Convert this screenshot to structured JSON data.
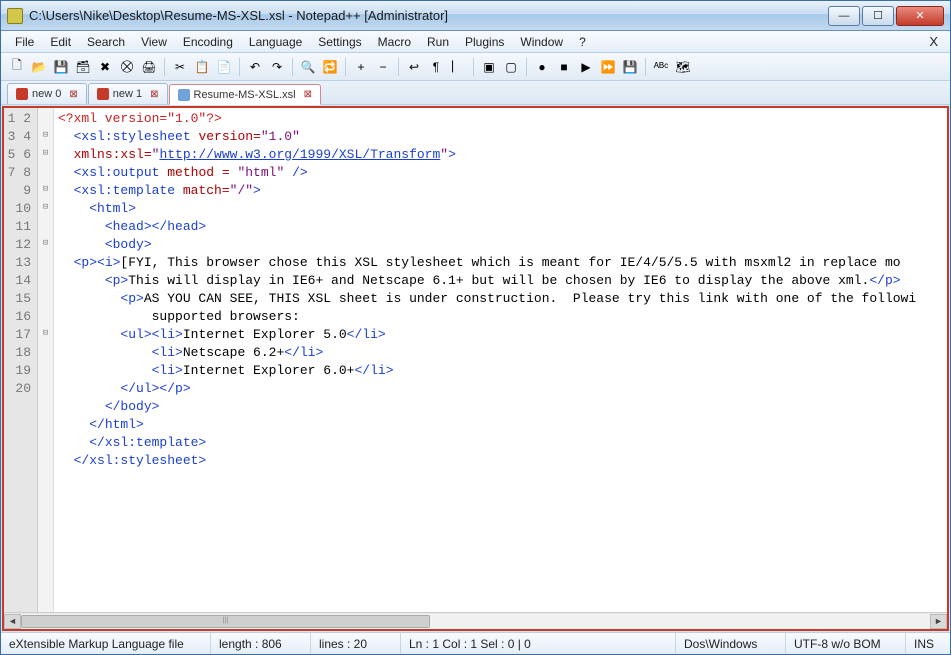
{
  "window": {
    "title": "C:\\Users\\Nike\\Desktop\\Resume-MS-XSL.xsl - Notepad++ [Administrator]"
  },
  "menu": {
    "items": [
      "File",
      "Edit",
      "Search",
      "View",
      "Encoding",
      "Language",
      "Settings",
      "Macro",
      "Run",
      "Plugins",
      "Window",
      "?"
    ],
    "close_doc": "X"
  },
  "toolbar": {
    "buttons": [
      {
        "name": "new-file-icon",
        "glyph": "🗋"
      },
      {
        "name": "open-file-icon",
        "glyph": "📂"
      },
      {
        "name": "save-icon",
        "glyph": "💾"
      },
      {
        "name": "save-all-icon",
        "glyph": "🗃"
      },
      {
        "name": "close-icon",
        "glyph": "✖"
      },
      {
        "name": "close-all-icon",
        "glyph": "⛒"
      },
      {
        "name": "print-icon",
        "glyph": "🖨"
      },
      {
        "sep": true
      },
      {
        "name": "cut-icon",
        "glyph": "✂"
      },
      {
        "name": "copy-icon",
        "glyph": "📋"
      },
      {
        "name": "paste-icon",
        "glyph": "📄"
      },
      {
        "sep": true
      },
      {
        "name": "undo-icon",
        "glyph": "↶"
      },
      {
        "name": "redo-icon",
        "glyph": "↷"
      },
      {
        "sep": true
      },
      {
        "name": "find-icon",
        "glyph": "🔍"
      },
      {
        "name": "replace-icon",
        "glyph": "🔁"
      },
      {
        "sep": true
      },
      {
        "name": "zoom-in-icon",
        "glyph": "+"
      },
      {
        "name": "zoom-out-icon",
        "glyph": "−"
      },
      {
        "sep": true
      },
      {
        "name": "wrap-icon",
        "glyph": "↩"
      },
      {
        "name": "invisible-chars-icon",
        "glyph": "¶"
      },
      {
        "name": "indent-guide-icon",
        "glyph": "⎸"
      },
      {
        "sep": true
      },
      {
        "name": "fold-all-icon",
        "glyph": "▣"
      },
      {
        "name": "unfold-all-icon",
        "glyph": "▢"
      },
      {
        "sep": true
      },
      {
        "name": "record-macro-icon",
        "glyph": "●"
      },
      {
        "name": "stop-macro-icon",
        "glyph": "■"
      },
      {
        "name": "play-macro-icon",
        "glyph": "▶"
      },
      {
        "name": "run-macro-multi-icon",
        "glyph": "⏩"
      },
      {
        "name": "save-macro-icon",
        "glyph": "💾"
      },
      {
        "sep": true
      },
      {
        "name": "spellcheck-icon",
        "glyph": "ᴬᴮᶜ"
      },
      {
        "name": "doc-map-icon",
        "glyph": "🗺"
      }
    ]
  },
  "tabs": {
    "items": [
      {
        "label": "new 0",
        "dirty": true,
        "active": false,
        "close": "⊠"
      },
      {
        "label": "new 1",
        "dirty": true,
        "active": false,
        "close": "⊠"
      },
      {
        "label": "Resume-MS-XSL.xsl",
        "dirty": false,
        "active": true,
        "close": "⊠"
      }
    ]
  },
  "editor": {
    "line_numbers": [
      "1",
      "2",
      "3",
      "4",
      "5",
      "6",
      "7",
      "8",
      "9",
      "10",
      "11",
      "12",
      "13",
      "14",
      "15",
      "16",
      "17",
      "18",
      "19",
      "20"
    ],
    "fold_markers": [
      "",
      "⊟",
      "⊟",
      "",
      "⊟",
      "⊟",
      "",
      "⊟",
      "",
      "",
      "",
      "",
      "⊟",
      "",
      "",
      "",
      "",
      "",
      "",
      ""
    ],
    "lines": [
      {
        "indent": 0,
        "raw": "<?xml version=\"1.0\"?>",
        "class": "dec"
      },
      {
        "indent": 1,
        "tag": "<xsl:stylesheet ",
        "attr": "version=",
        "str": "\"1.0\""
      },
      {
        "indent": 1,
        "attr": "xmlns:xsl=",
        "str_pre": "\"",
        "url": "http://www.w3.org/1999/XSL/Transform",
        "str_post": "\"",
        "tag_post": ">"
      },
      {
        "indent": 1,
        "tag": "<xsl:output ",
        "attr": "method = ",
        "str": "\"html\"",
        "tag_post": " />"
      },
      {
        "indent": 1,
        "tag": "<xsl:template ",
        "attr": "match=",
        "str": "\"/\"",
        "tag_post": ">"
      },
      {
        "indent": 2,
        "tag": "<html>"
      },
      {
        "indent": 3,
        "tag": "<head></head>"
      },
      {
        "indent": 3,
        "tag": "<body>"
      },
      {
        "indent": 1,
        "tag": "<p><i>",
        "text": "[FYI, This browser chose this XSL stylesheet which is meant for IE/4/5/5.5 with msxml2 in replace mo"
      },
      {
        "indent": 3,
        "tag": "<p>",
        "text": "This will display in IE6+ and Netscape 6.1+ but will be chosen by IE6 to display the above xml.",
        "tag_post": "</p>"
      },
      {
        "indent": 4,
        "tag": "<p>",
        "text": "AS YOU CAN SEE, THIS XSL sheet is under construction.  Please try this link with one of the followi"
      },
      {
        "indent": 6,
        "text": "supported browsers:"
      },
      {
        "indent": 4,
        "tag": "<ul><li>",
        "text": "Internet Explorer 5.0",
        "tag_post": "</li>"
      },
      {
        "indent": 6,
        "tag": "<li>",
        "text": "Netscape 6.2+",
        "tag_post": "</li>"
      },
      {
        "indent": 6,
        "tag": "<li>",
        "text": "Internet Explorer 6.0+",
        "tag_post": "</li>"
      },
      {
        "indent": 4,
        "tag": "</ul></p>"
      },
      {
        "indent": 3,
        "tag": "</body>"
      },
      {
        "indent": 2,
        "tag": "</html>"
      },
      {
        "indent": 2,
        "tag": "</xsl:template>"
      },
      {
        "indent": 1,
        "tag": "</xsl:stylesheet>"
      }
    ]
  },
  "status": {
    "file_type": "eXtensible Markup Language file",
    "length": "length : 806",
    "lines": "lines : 20",
    "pos": "Ln : 1    Col : 1    Sel : 0 | 0",
    "eol": "Dos\\Windows",
    "enc": "UTF-8 w/o BOM",
    "mode": "INS"
  }
}
